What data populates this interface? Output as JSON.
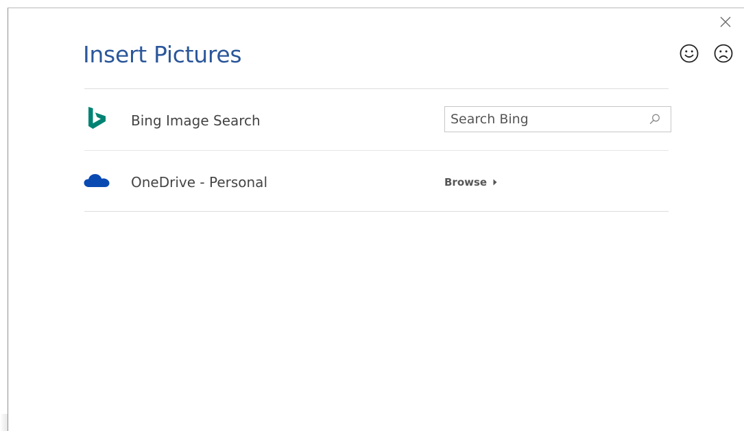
{
  "dialog": {
    "title": "Insert Pictures"
  },
  "window_controls": {
    "close_icon": "close-icon",
    "smile_icon": "smile-icon",
    "frown_icon": "frown-icon"
  },
  "sources": [
    {
      "icon": "bing-logo-icon",
      "label": "Bing Image Search",
      "action_type": "search",
      "search_placeholder": "Search Bing",
      "search_value": "",
      "search_icon": "search-icon"
    },
    {
      "icon": "onedrive-cloud-icon",
      "label": "OneDrive - Personal",
      "action_type": "browse",
      "browse_label": "Browse",
      "browse_icon": "caret-right-icon"
    }
  ],
  "colors": {
    "title": "#2b579a",
    "bing_logo": "#008373",
    "onedrive_cloud": "#094ab2",
    "text": "#444444",
    "divider": "#dcdcdc"
  }
}
